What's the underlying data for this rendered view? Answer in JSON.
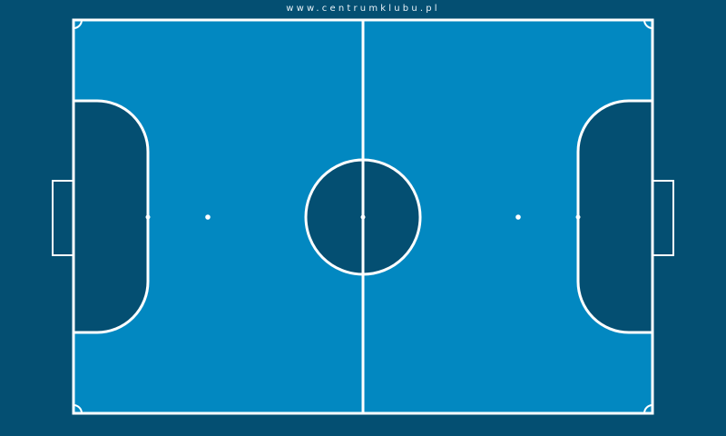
{
  "watermark": "www.centrumklubu.pl",
  "colors": {
    "background": "#044f72",
    "pitch": "#0288c1",
    "penalty_area": "#044f72",
    "center_circle": "#044f72",
    "lines": "#ffffff"
  }
}
